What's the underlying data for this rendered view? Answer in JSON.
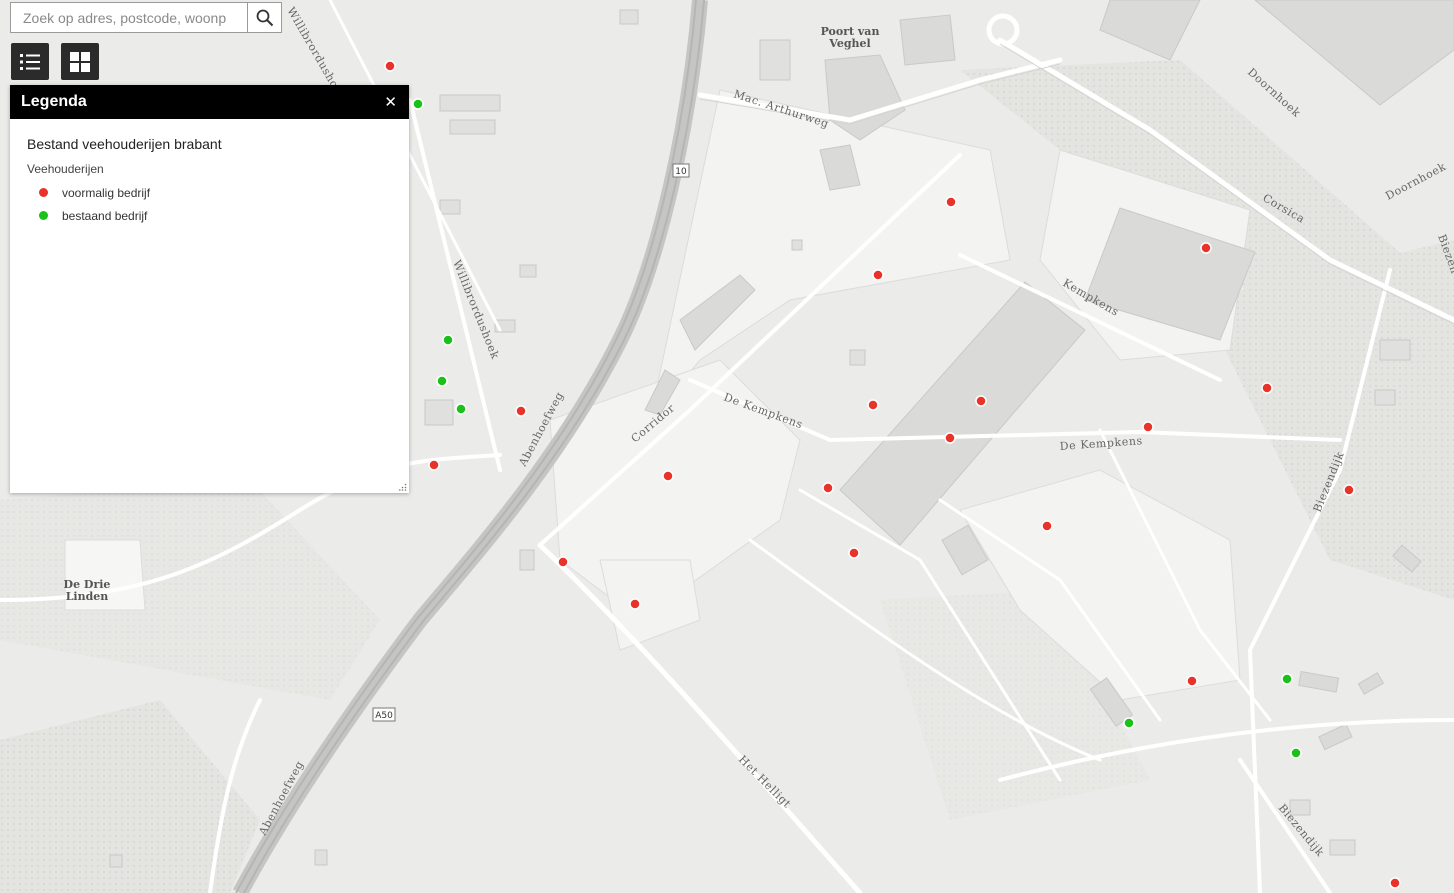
{
  "search": {
    "placeholder": "Zoek op adres, postcode, woonp"
  },
  "toolbar": {
    "legend_icon": "list-icon",
    "basemap_icon": "grid-icon"
  },
  "legend": {
    "title": "Legenda",
    "close": "✕",
    "layer_title": "Bestand veehouderijen brabant",
    "group_title": "Veehouderijen",
    "items": [
      {
        "label": "voormalig bedrijf",
        "color": "#e8332a"
      },
      {
        "label": "bestaand bedrijf",
        "color": "#19c119"
      }
    ]
  },
  "map": {
    "place_labels": [
      "Poort van",
      "Veghel",
      "De Drie",
      "Linden"
    ],
    "street_labels": [
      "Willibrordushoek",
      "Willibrordushoek",
      "Mac. Arthurweg",
      "Doornhoek",
      "Doornhoek",
      "Corsica",
      "Kempkens",
      "De Kempkens",
      "De Kempkens",
      "Corridor",
      "Abenhoefweg",
      "Abenhoefweg",
      "Biezendijk",
      "Biezendijk",
      "Het Helligt",
      "Biezen"
    ],
    "shields": [
      "10",
      "A50"
    ]
  }
}
